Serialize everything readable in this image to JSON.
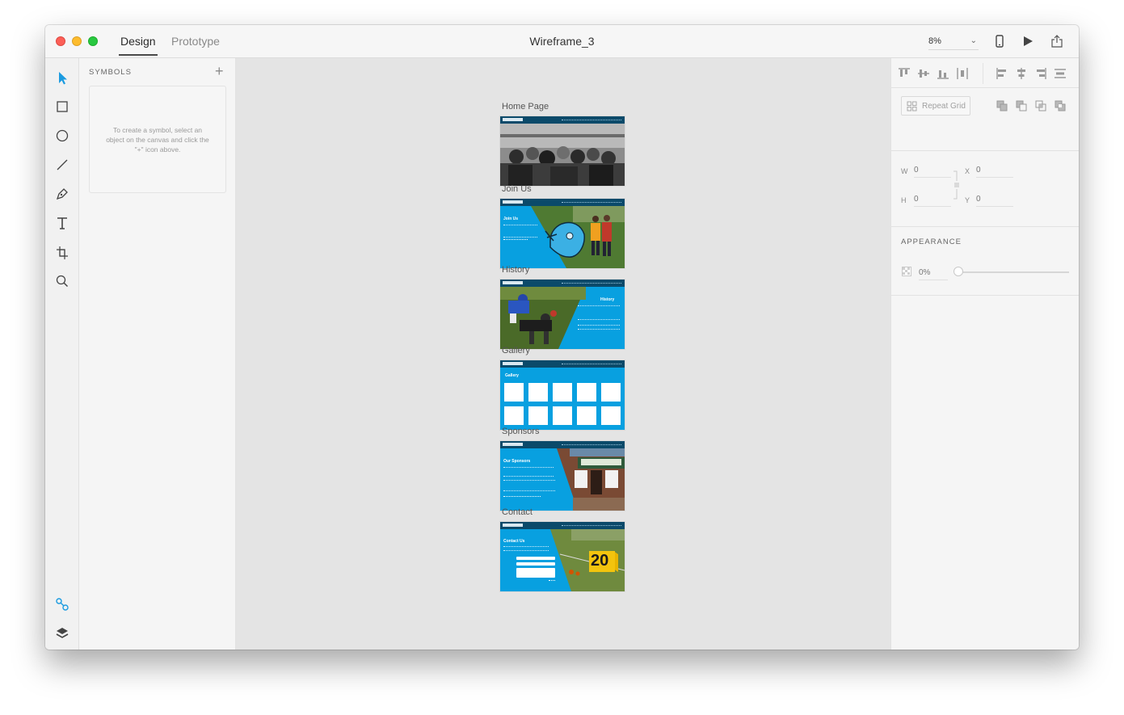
{
  "window": {
    "tabs": [
      {
        "label": "Design"
      },
      {
        "label": "Prototype"
      }
    ],
    "title": "Wireframe_3",
    "zoom": "8%"
  },
  "symbols_panel": {
    "title": "SYMBOLS",
    "hint": "To create a symbol, select an object on the canvas and click the \"+\" icon above."
  },
  "artboards": [
    {
      "label": "Home Page"
    },
    {
      "label": "Join Us"
    },
    {
      "label": "History"
    },
    {
      "label": "Gallery"
    },
    {
      "label": "Sponsors"
    },
    {
      "label": "Contact"
    }
  ],
  "artboard_text": {
    "join_heading": "Join Us",
    "history_heading": "History",
    "gallery_heading": "Gallery",
    "sponsors_heading": "Our Sponsors",
    "contact_heading": "Contact Us",
    "yardage": "20"
  },
  "properties": {
    "repeat_grid": "Repeat Grid",
    "w_label": "W",
    "w_value": "0",
    "h_label": "H",
    "h_value": "0",
    "x_label": "X",
    "x_value": "0",
    "y_label": "Y",
    "y_value": "0",
    "appearance_title": "APPEARANCE",
    "opacity_value": "0%"
  },
  "colors": {
    "accent": "#1b9be0",
    "artboard_blue": "#08a0e0",
    "nav_dark": "#0b4a6a"
  }
}
